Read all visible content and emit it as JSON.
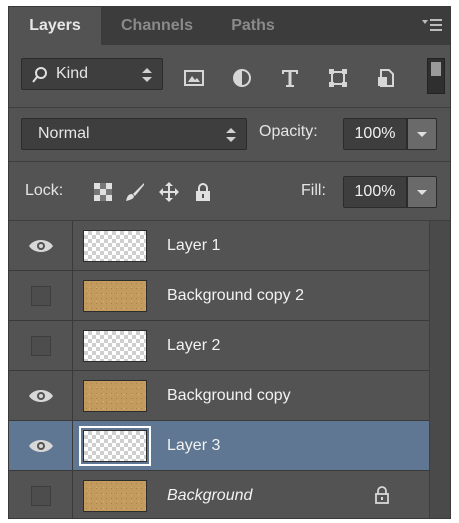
{
  "tabs": [
    {
      "label": "Layers",
      "active": true
    },
    {
      "label": "Channels",
      "active": false
    },
    {
      "label": "Paths",
      "active": false
    }
  ],
  "filter": {
    "kind_label": "Kind",
    "icons": [
      "image-filter-icon",
      "adjustment-filter-icon",
      "type-filter-icon",
      "shape-filter-icon",
      "smart-object-filter-icon"
    ]
  },
  "blend": {
    "mode": "Normal",
    "opacity_label": "Opacity:",
    "opacity_value": "100%"
  },
  "lock": {
    "label": "Lock:",
    "icons": [
      "lock-transparent-pixels-icon",
      "lock-image-pixels-icon",
      "lock-position-icon",
      "lock-all-icon"
    ],
    "fill_label": "Fill:",
    "fill_value": "100%"
  },
  "layers": [
    {
      "name": "Layer 1",
      "visible": true,
      "thumb": "transparent",
      "selected": false,
      "italic": false,
      "locked": false
    },
    {
      "name": "Background copy 2",
      "visible": false,
      "thumb": "sand",
      "selected": false,
      "italic": false,
      "locked": false
    },
    {
      "name": "Layer 2",
      "visible": false,
      "thumb": "transparent",
      "selected": false,
      "italic": false,
      "locked": false
    },
    {
      "name": "Background copy",
      "visible": true,
      "thumb": "sand",
      "selected": false,
      "italic": false,
      "locked": false
    },
    {
      "name": "Layer 3",
      "visible": true,
      "thumb": "transparent",
      "selected": true,
      "italic": false,
      "locked": false
    },
    {
      "name": "Background",
      "visible": false,
      "thumb": "sand",
      "selected": false,
      "italic": true,
      "locked": true
    }
  ],
  "colors": {
    "panel": "#535353",
    "selected_row": "#5f7792",
    "tab_bar": "#3c3c3c"
  }
}
